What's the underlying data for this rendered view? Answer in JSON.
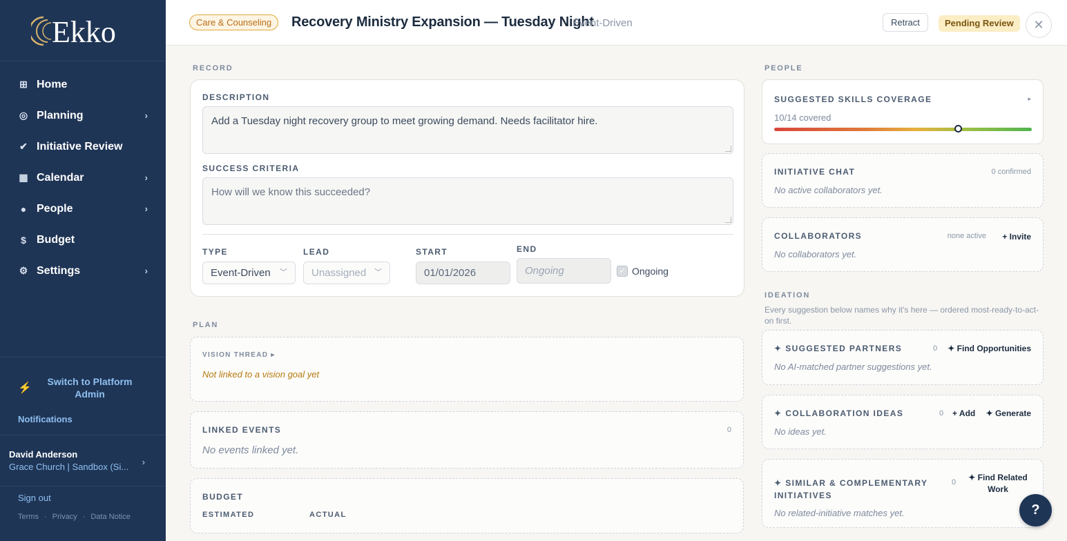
{
  "brand": {
    "name": "Ekko",
    "accent": "#1f3556"
  },
  "sidebar": {
    "items": [
      {
        "label": "Home",
        "icon": "grid-icon",
        "chevron": false
      },
      {
        "label": "Planning",
        "icon": "target-icon",
        "chevron": true
      },
      {
        "label": "Initiative Review",
        "icon": "check-icon",
        "chevron": false
      },
      {
        "label": "Calendar",
        "icon": "calendar-icon",
        "chevron": true
      },
      {
        "label": "People",
        "icon": "dot-icon",
        "chevron": true
      },
      {
        "label": "Budget",
        "icon": "dollar-icon",
        "chevron": false
      },
      {
        "label": "Settings",
        "icon": "gear-icon",
        "chevron": true
      }
    ],
    "switch_label": "Switch to Platform Admin",
    "notifications_label": "Notifications",
    "user": {
      "name": "David Anderson",
      "org": "Grace Church | Sandbox (Si..."
    },
    "sign_out": "Sign out",
    "legal": {
      "terms": "Terms",
      "privacy": "Privacy",
      "data_notice": "Data Notice",
      "sep": "·"
    }
  },
  "header": {
    "category": "Care & Counseling",
    "title": "Recovery Ministry Expansion — Tuesday Night",
    "subtitle": "Event-Driven",
    "retract": "Retract",
    "status": "Pending Review",
    "close": "✕"
  },
  "record": {
    "section": "RECORD",
    "description_label": "DESCRIPTION",
    "description_value": "Add a Tuesday night recovery group to meet growing demand. Needs facilitator hire.",
    "success_label": "SUCCESS CRITERIA",
    "success_placeholder": "How will we know this succeeded?",
    "type_label": "TYPE",
    "type_value": "Event-Driven",
    "lead_label": "LEAD",
    "lead_value": "Unassigned",
    "start_label": "START",
    "start_value": "01/01/2026",
    "end_label": "END",
    "end_placeholder": "Ongoing",
    "ongoing_label": "Ongoing",
    "ongoing_checked": true
  },
  "plan": {
    "section": "PLAN",
    "vision_label": "VISION THREAD ▸",
    "vision_empty": "Not linked to a vision goal yet",
    "linked_label": "LINKED EVENTS",
    "linked_count": "0",
    "linked_empty": "No events linked yet.",
    "budget_label": "BUDGET",
    "estimated_label": "ESTIMATED",
    "actual_label": "ACTUAL"
  },
  "people": {
    "section": "PEOPLE",
    "skills_label": "SUGGESTED SKILLS COVERAGE",
    "skills_caret": "▸",
    "skills_text": "10/14 covered",
    "skills_fraction": 0.714,
    "chat_label": "INITIATIVE CHAT",
    "chat_count": "0 confirmed",
    "chat_empty": "No active collaborators yet.",
    "collab_label": "COLLABORATORS",
    "collab_status": "none active",
    "collab_invite": "+ Invite",
    "collab_empty": "No collaborators yet."
  },
  "ideation": {
    "section": "IDEATION",
    "intro": "Every suggestion below names why it's here — ordered most-ready-to-act-on first.",
    "partners_label": "✦ SUGGESTED PARTNERS",
    "partners_count": "0",
    "partners_action": "✦ Find Opportunities",
    "partners_empty": "No AI-matched partner suggestions yet.",
    "ideas_label": "✦ COLLABORATION IDEAS",
    "ideas_count": "0",
    "ideas_add": "+ Add",
    "ideas_generate": "✦ Generate",
    "ideas_empty": "No ideas yet.",
    "similar_label": "✦ SIMILAR & COMPLEMENTARY INITIATIVES",
    "similar_count": "0",
    "similar_action": "✦ Find Related Work",
    "similar_empty": "No related-initiative matches yet."
  },
  "help": "?"
}
